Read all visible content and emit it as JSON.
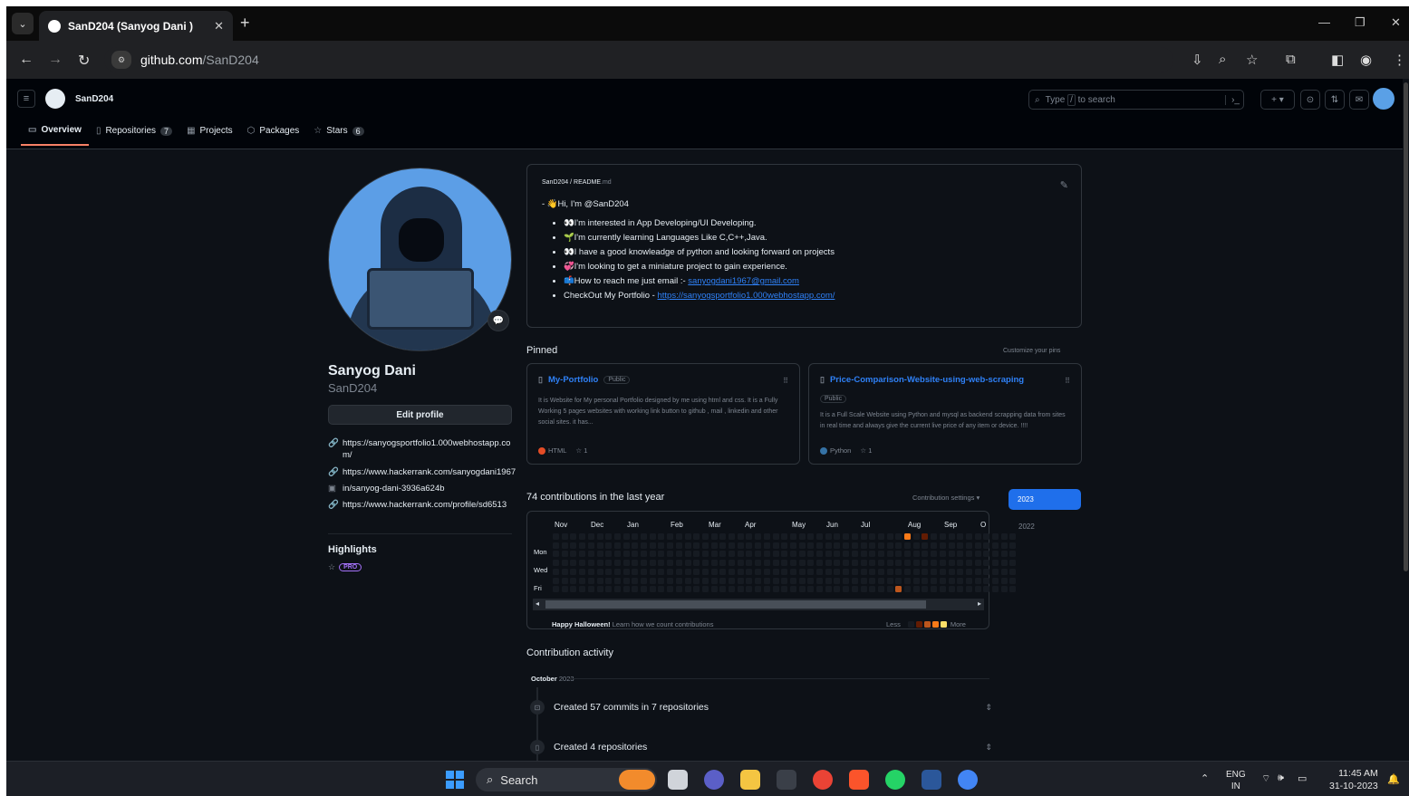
{
  "browser": {
    "tab_title": "SanD204 (Sanyog Dani )",
    "url_domain": "github.com",
    "url_path": "/SanD204"
  },
  "gh_header": {
    "username": "SanD204",
    "search_placeholder_a": "Type",
    "search_placeholder_key": "/",
    "search_placeholder_b": "to search",
    "tabs": [
      {
        "label": "Overview"
      },
      {
        "label": "Repositories",
        "count": "7"
      },
      {
        "label": "Projects"
      },
      {
        "label": "Packages"
      },
      {
        "label": "Stars",
        "count": "6"
      }
    ]
  },
  "profile": {
    "name": "Sanyog Dani",
    "login": "SanD204",
    "edit_label": "Edit profile",
    "links": [
      "https://sanyogsportfolio1.000webhostapp.com/",
      "https://www.hackerrank.com/sanyogdani1967",
      "in/sanyog-dani-3936a624b",
      "https://www.hackerrank.com/profile/sd6513"
    ],
    "highlights_title": "Highlights",
    "pro_label": "PRO"
  },
  "readme": {
    "path_user": "SanD204",
    "path_sep": " / ",
    "path_file": "README",
    "path_ext": ".md",
    "greeting_prefix": "- ",
    "greeting": "Hi, I'm @SanD204",
    "items": [
      "I'm interested in App Developing/UI Developing.",
      "I'm currently learning Languages Like C,C++,Java.",
      "I have a good knowleadge of python and looking forward on projects",
      "I'm looking to get a miniature project to gain experience."
    ],
    "email_prefix": "How to reach me just email :- ",
    "email": "sanyogdani1967@gmail.com",
    "portfolio_prefix": "CheckOut My Portfolio - ",
    "portfolio_url": "https://sanyogsportfolio1.000webhostapp.com/"
  },
  "pinned": {
    "title": "Pinned",
    "customize": "Customize your pins",
    "repos": [
      {
        "name": "My-Portfolio",
        "visibility": "Public",
        "description": "It is Website for My personal Portfolio designed by me using html and css. It is a Fully Working 5 pages websites with working link button to github , mail , linkedin and other social sites. it has...",
        "language": "HTML",
        "language_color": "#e34c26",
        "stars": "1"
      },
      {
        "name": "Price-Comparison-Website-using-web-scraping",
        "visibility": "Public",
        "description": "It is a Full Scale Website using Python and mysql as backend scrapping data from sites in real time and always give the current live price of any item or device. !!!!",
        "language": "Python",
        "language_color": "#3572A5",
        "stars": "1"
      }
    ]
  },
  "contributions": {
    "title": "74 contributions in the last year",
    "settings": "Contribution settings",
    "years": [
      "2023",
      "2022"
    ],
    "months": [
      "Nov",
      "Dec",
      "Jan",
      "Feb",
      "Mar",
      "Apr",
      "May",
      "Jun",
      "Jul",
      "Aug",
      "Sep",
      "O"
    ],
    "days": [
      "Mon",
      "Wed",
      "Fri"
    ],
    "footer_bold": "Happy Halloween!",
    "footer_link": "Learn how we count contributions",
    "less": "Less",
    "more": "More",
    "legend_colors": [
      "#161b22",
      "#631c03",
      "#bd561d",
      "#fa7a18",
      "#fddf68"
    ]
  },
  "activity": {
    "title": "Contribution activity",
    "month": "October",
    "year": "2023",
    "items": [
      "Created 57 commits in 7 repositories",
      "Created 4 repositories"
    ]
  },
  "taskbar": {
    "search": "Search",
    "lang_top": "ENG",
    "lang_bottom": "IN",
    "time": "11:45 AM",
    "date": "31-10-2023"
  }
}
